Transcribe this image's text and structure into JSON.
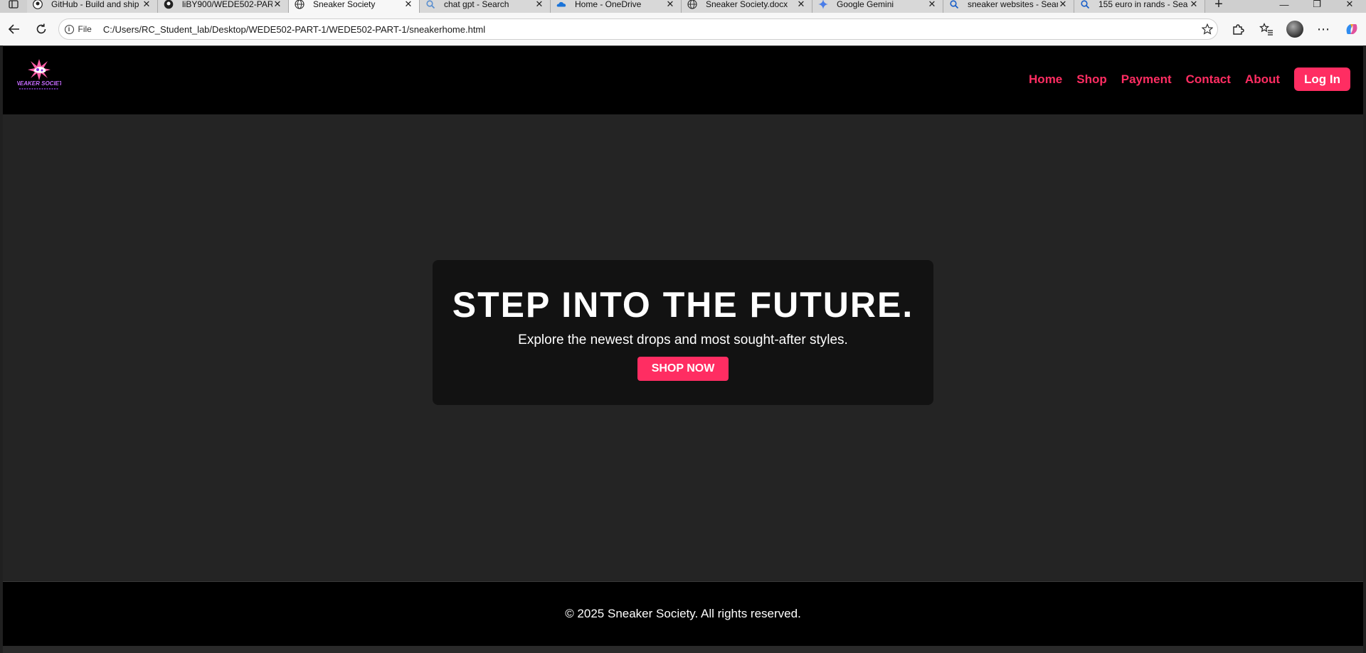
{
  "browser": {
    "tabs": [
      {
        "title": "GitHub - Build and ship",
        "icon": "github-icon",
        "active": false
      },
      {
        "title": "liBY900/WEDE502-PAR",
        "icon": "github-icon",
        "active": false
      },
      {
        "title": "Sneaker Society",
        "icon": "globe-icon",
        "active": true
      },
      {
        "title": "chat gpt - Search",
        "icon": "search-icon",
        "active": false
      },
      {
        "title": "Home - OneDrive",
        "icon": "onedrive-icon",
        "active": false
      },
      {
        "title": "Sneaker Society.docx",
        "icon": "globe-icon",
        "active": false
      },
      {
        "title": "Google Gemini",
        "icon": "gemini-icon",
        "active": false
      },
      {
        "title": "sneaker websites - Sear",
        "icon": "search-icon",
        "active": false
      },
      {
        "title": "155 euro in rands - Sea",
        "icon": "search-icon",
        "active": false
      }
    ],
    "address": {
      "scheme_label": "File",
      "url": "C:/Users/RC_Student_lab/Desktop/WEDE502-PART-1/WEDE502-PART-1/sneakerhome.html"
    }
  },
  "site": {
    "logo_text": "SNEAKER SOCIETY",
    "nav": {
      "home": "Home",
      "shop": "Shop",
      "payment": "Payment",
      "contact": "Contact",
      "about": "About",
      "login": "Log In"
    },
    "hero": {
      "title": "STEP INTO THE FUTURE.",
      "subtitle": "Explore the newest drops and most sought-after styles.",
      "cta": "SHOP NOW"
    },
    "footer": {
      "text": "© 2025 Sneaker Society. All rights reserved."
    }
  },
  "colors": {
    "accent": "#ff2d62",
    "header_bg": "#000000",
    "hero_bg": "#242424",
    "card_bg": "#121212"
  }
}
